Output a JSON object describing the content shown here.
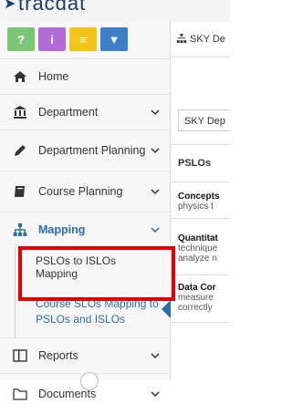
{
  "app": {
    "logo_text": "tracdat"
  },
  "toolbar": {
    "help": "?",
    "info": "i",
    "notes": "≡",
    "filter": "▼",
    "colors": {
      "green": "#7cc576",
      "purple": "#b26ad8",
      "yellow": "#f0c419",
      "blue": "#3d7ec9"
    }
  },
  "sidebar": {
    "items": [
      {
        "label": "Home"
      },
      {
        "label": "Department"
      },
      {
        "label": "Department Planning"
      },
      {
        "label": "Course Planning"
      },
      {
        "label": "Mapping"
      },
      {
        "label": "Reports"
      },
      {
        "label": "Documents"
      }
    ],
    "mapping_children": [
      {
        "label": "PSLOs to ISLOs Mapping"
      },
      {
        "label": "Course SLOs Mapping to PSLOs and ISLOs"
      }
    ]
  },
  "main": {
    "breadcrumb": "SKY De",
    "select_value": "SKY Dep",
    "table_header": "PSLOs",
    "rows": [
      {
        "title": "Concepts",
        "desc": "physics t"
      },
      {
        "title": "Quantitat",
        "desc1": "technique",
        "desc2": "analyze n"
      },
      {
        "title": "Data Cor",
        "desc1": "measure",
        "desc2": "correctly"
      }
    ]
  },
  "highlight_color": "#e00000",
  "accent": "#2b6cb0"
}
